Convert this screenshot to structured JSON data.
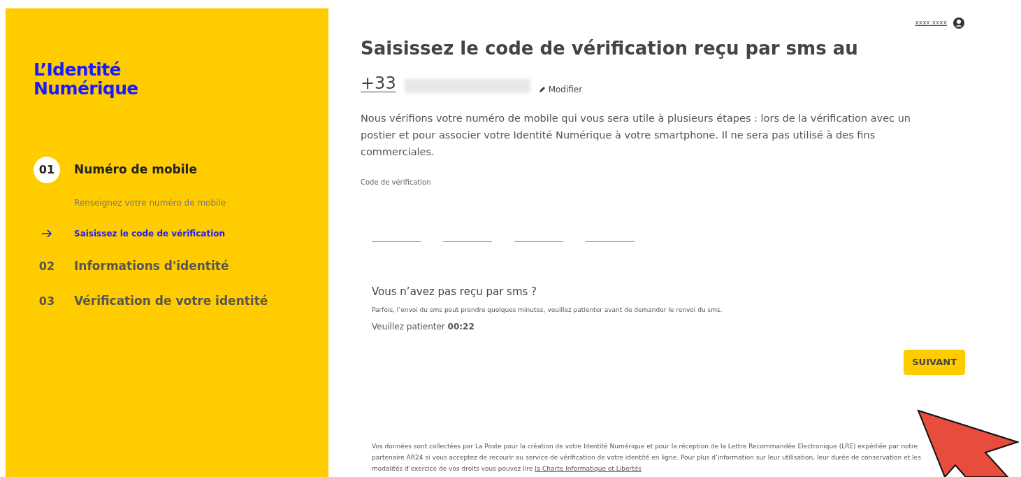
{
  "sidebar": {
    "logo": [
      "L’Identité",
      "Numérique"
    ],
    "steps": [
      {
        "number": "01",
        "label": "Numéro de mobile",
        "selected": true,
        "substeps": [
          {
            "label": "Renseignez votre numéro de mobile",
            "selected": false
          },
          {
            "label": "Saisissez le code de vérification",
            "selected": true
          }
        ]
      },
      {
        "number": "02",
        "label": "Informations d'identité",
        "selected": false
      },
      {
        "number": "03",
        "label": "Vérification de votre identité",
        "selected": false
      }
    ]
  },
  "user": {
    "name": "xxxx xxxx"
  },
  "title": "Saisissez le code de vérification reçu par sms au",
  "phone": {
    "prefix": "+33",
    "edit_link": "Modifier"
  },
  "description": "Nous vérifions votre numéro de mobile qui vous sera utile à plusieurs étapes : lors de la vérification avec un postier et pour associer votre Identité Numérique à votre smartphone. Il ne sera pas utilisé à des fins commerciales.",
  "code": {
    "label": "Code de vérification"
  },
  "resend": {
    "title": "Vous n’avez pas reçu par sms ?",
    "text": "Parfois, l’envoi du sms peut prendre quelques minutes, veuillez patienter avant de demander le renvoi du sms.",
    "wait": "Veuillez patienter **00:22**"
  },
  "next_button": "SUIVANT",
  "legal": {
    "text": "Vos données sont collectées par La Poste pour la création de votre Identité Numérique et pour la réception de la Lettre Recommandée Electronique (LRE) expédiée par notre partenaire AR24 si vous acceptez de recourir au service de vérification de votre identité en ligne. Pour plus d’information sur leur utilisation, leur durée de conservation et les modalités d’exercice de vos droits vous pouvez lire",
    "link": "la Charte Informatique et Libertés"
  }
}
